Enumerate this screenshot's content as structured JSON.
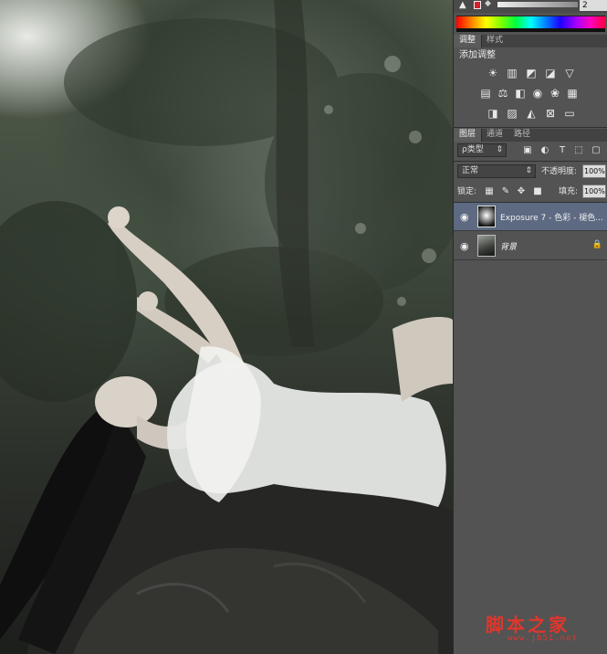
{
  "color_bar": {
    "value_field": "2",
    "fg_color": "#d4202a",
    "spectrum": true
  },
  "adjust_panel": {
    "tabs": [
      {
        "label": "调整",
        "active": true
      },
      {
        "label": "样式",
        "active": false
      }
    ],
    "title": "添加调整",
    "icons_row1": [
      "brightness-icon",
      "levels-icon",
      "curves-icon",
      "exposure-icon",
      "vibrance-icon"
    ],
    "icons_row2": [
      "hue-saturation-icon",
      "color-balance-icon",
      "black-white-icon",
      "photo-filter-icon",
      "channel-mixer-icon",
      "color-lookup-icon"
    ],
    "icons_row3": [
      "invert-icon",
      "posterize-icon",
      "threshold-icon",
      "selective-color-icon",
      "gradient-map-icon"
    ]
  },
  "layers_panel": {
    "tabs": [
      {
        "label": "图层",
        "active": true
      },
      {
        "label": "通道",
        "active": false
      },
      {
        "label": "路径",
        "active": false
      }
    ],
    "filter_label": "ρ类型",
    "blend_mode": "正常",
    "opacity_label": "不透明度:",
    "opacity_value": "100%",
    "lock_label": "锁定:",
    "fill_label": "填充:",
    "fill_value": "100%",
    "layers": [
      {
        "name": "Exposure 7 - 色彩 - 褪色...",
        "selected": true
      },
      {
        "name": "背景",
        "selected": false
      }
    ]
  },
  "watermark": {
    "text": "脚本之家",
    "url": "www.jb51.net",
    "color": "#e1362b"
  }
}
